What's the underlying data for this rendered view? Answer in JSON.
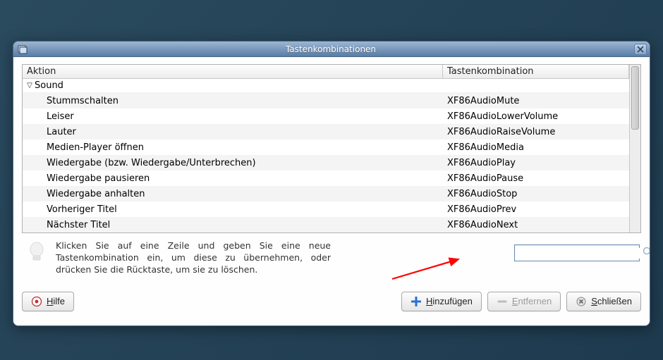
{
  "window": {
    "title": "Tastenkombinationen"
  },
  "table": {
    "headers": {
      "action": "Aktion",
      "combo": "Tastenkombination"
    },
    "group": "Sound",
    "rows": [
      {
        "action": "Stummschalten",
        "combo": "XF86AudioMute"
      },
      {
        "action": "Leiser",
        "combo": "XF86AudioLowerVolume"
      },
      {
        "action": "Lauter",
        "combo": "XF86AudioRaiseVolume"
      },
      {
        "action": "Medien-Player öffnen",
        "combo": "XF86AudioMedia"
      },
      {
        "action": "Wiedergabe (bzw. Wiedergabe/Unterbrechen)",
        "combo": "XF86AudioPlay"
      },
      {
        "action": "Wiedergabe pausieren",
        "combo": "XF86AudioPause"
      },
      {
        "action": "Wiedergabe anhalten",
        "combo": "XF86AudioStop"
      },
      {
        "action": "Vorheriger Titel",
        "combo": "XF86AudioPrev"
      },
      {
        "action": "Nächster Titel",
        "combo": "XF86AudioNext"
      }
    ]
  },
  "hint": "Klicken Sie auf eine Zeile und geben Sie eine neue Tastenkombination ein, um diese zu übernehmen, oder drücken Sie die Rücktaste, um sie zu löschen.",
  "search": {
    "value": ""
  },
  "buttons": {
    "help": "Hilfe",
    "add": "Hinzufügen",
    "remove": "Entfernen",
    "close": "Schließen"
  }
}
